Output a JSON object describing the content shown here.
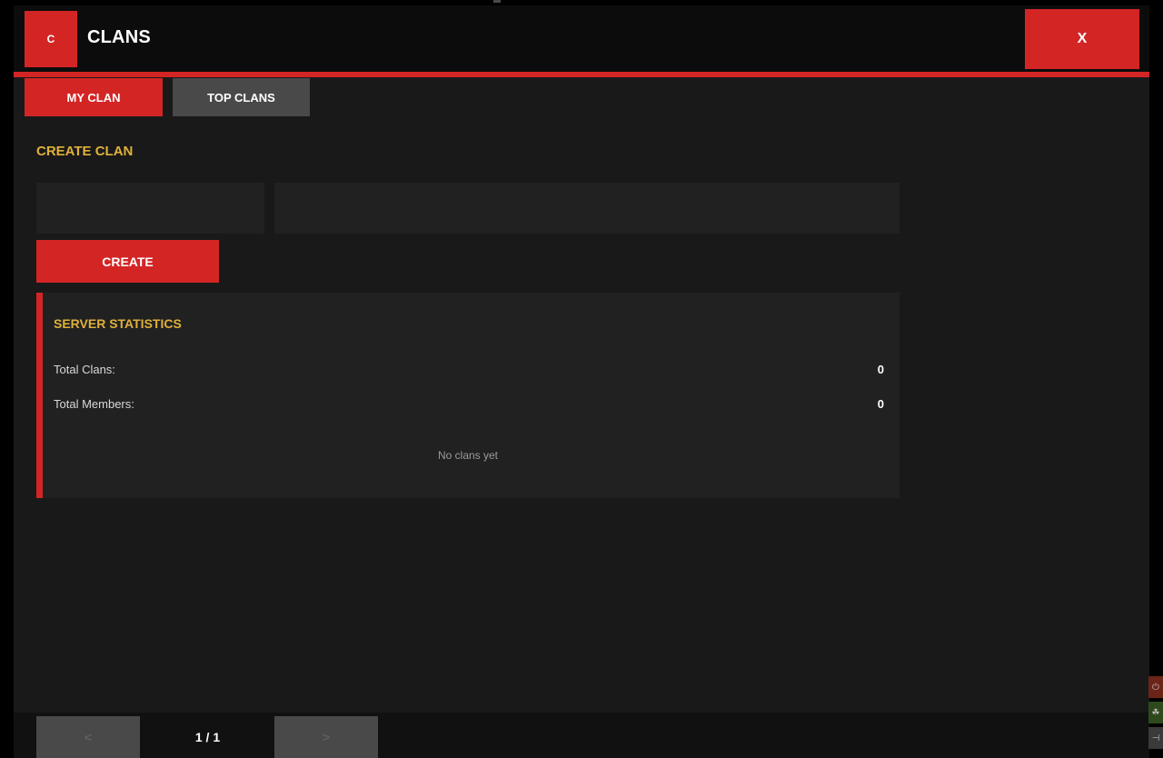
{
  "header": {
    "logo_letter": "C",
    "title": "CLANS",
    "close_label": "X"
  },
  "tabs": [
    {
      "label": "MY CLAN",
      "active": true
    },
    {
      "label": "TOP CLANS",
      "active": false
    }
  ],
  "create_section": {
    "title": "CREATE CLAN",
    "name_value": "",
    "tag_value": "",
    "create_label": "CREATE"
  },
  "stats": {
    "title": "SERVER STATISTICS",
    "rows": [
      {
        "label": "Total Clans:",
        "value": "0"
      },
      {
        "label": "Total Members:",
        "value": "0"
      }
    ],
    "empty_message": "No clans yet"
  },
  "pagination": {
    "prev_label": "<",
    "page_text": "1 / 1",
    "next_label": ">"
  },
  "tray_icons": [
    "power-icon",
    "leaf-icon",
    "plug-icon"
  ],
  "colors": {
    "accent": "#d42525",
    "heading": "#e0b03a",
    "panel": "#191919",
    "header": "#0c0c0c"
  }
}
